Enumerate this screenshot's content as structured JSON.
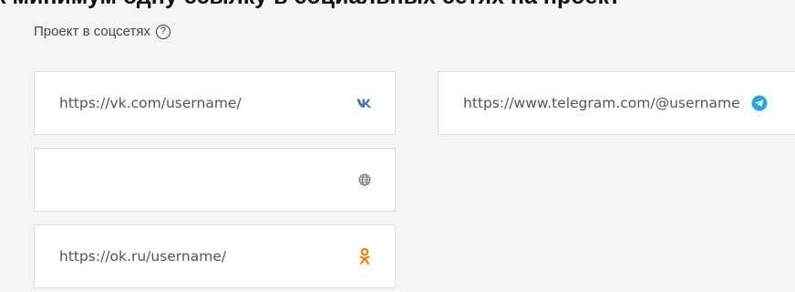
{
  "page": {
    "heading": "к минимум одну ссылку в социальных сетях на проект"
  },
  "section": {
    "title": "Проект в соцсетях",
    "help_icon": "?"
  },
  "fields": {
    "vk": {
      "value": "https://vk.com/username/",
      "placeholder": "",
      "icon": "vk-icon",
      "color": "#4a76a8"
    },
    "telegram": {
      "value": "https://www.telegram.com/@username",
      "placeholder": "",
      "icon": "telegram-icon",
      "color": "#2ea3e0"
    },
    "website": {
      "value": "",
      "placeholder": "",
      "icon": "globe-icon",
      "color": "#777777"
    },
    "ok": {
      "value": "https://ok.ru/username/",
      "placeholder": "",
      "icon": "odnoklassniki-icon",
      "color": "#ee8208"
    }
  }
}
